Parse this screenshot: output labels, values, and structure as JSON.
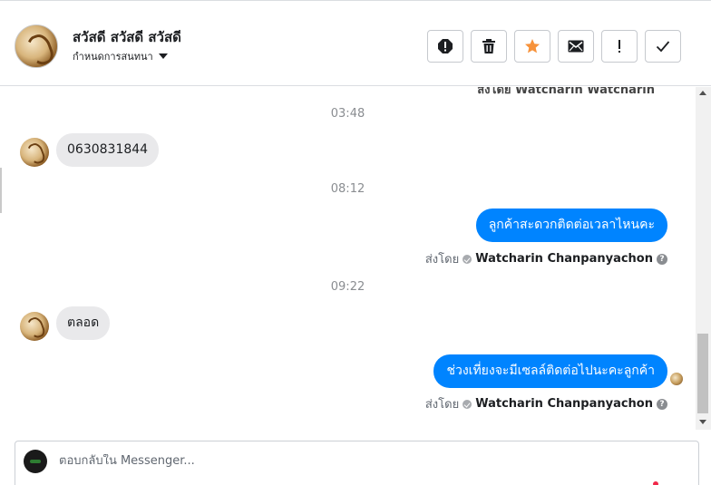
{
  "header": {
    "title": "สวัสดี สวัสดี สวัสดี",
    "subtitle": "กำหนดการสนทนา",
    "actions": [
      "spam-icon",
      "trash-icon",
      "star-icon",
      "envelope-icon",
      "exclamation-icon",
      "check-icon"
    ],
    "star_color": "#f7923a"
  },
  "chat": {
    "clipped_top_text": "ส่งโดย Watcharin Watcharin",
    "messages": [
      {
        "time": "03:48"
      },
      {
        "incoming": "0630831844"
      },
      {
        "time": "08:12"
      },
      {
        "outgoing": "ลูกค้าสะดวกติดต่อเวลาไหนคะ",
        "sent_prefix": "ส่งโดย",
        "sender": "Watcharin Chanpanyachon"
      },
      {
        "time": "09:22"
      },
      {
        "incoming": "ตลอด"
      },
      {
        "outgoing": "ช่วงเที่ยงจะมีเซลล์ติดต่อไปนะคะลูกค้า",
        "sent_prefix": "ส่งโดย",
        "sender": "Watcharin Chanpanyachon"
      }
    ],
    "accent": "#0084ff"
  },
  "composer": {
    "placeholder": "ตอบกลับใน Messenger..."
  }
}
